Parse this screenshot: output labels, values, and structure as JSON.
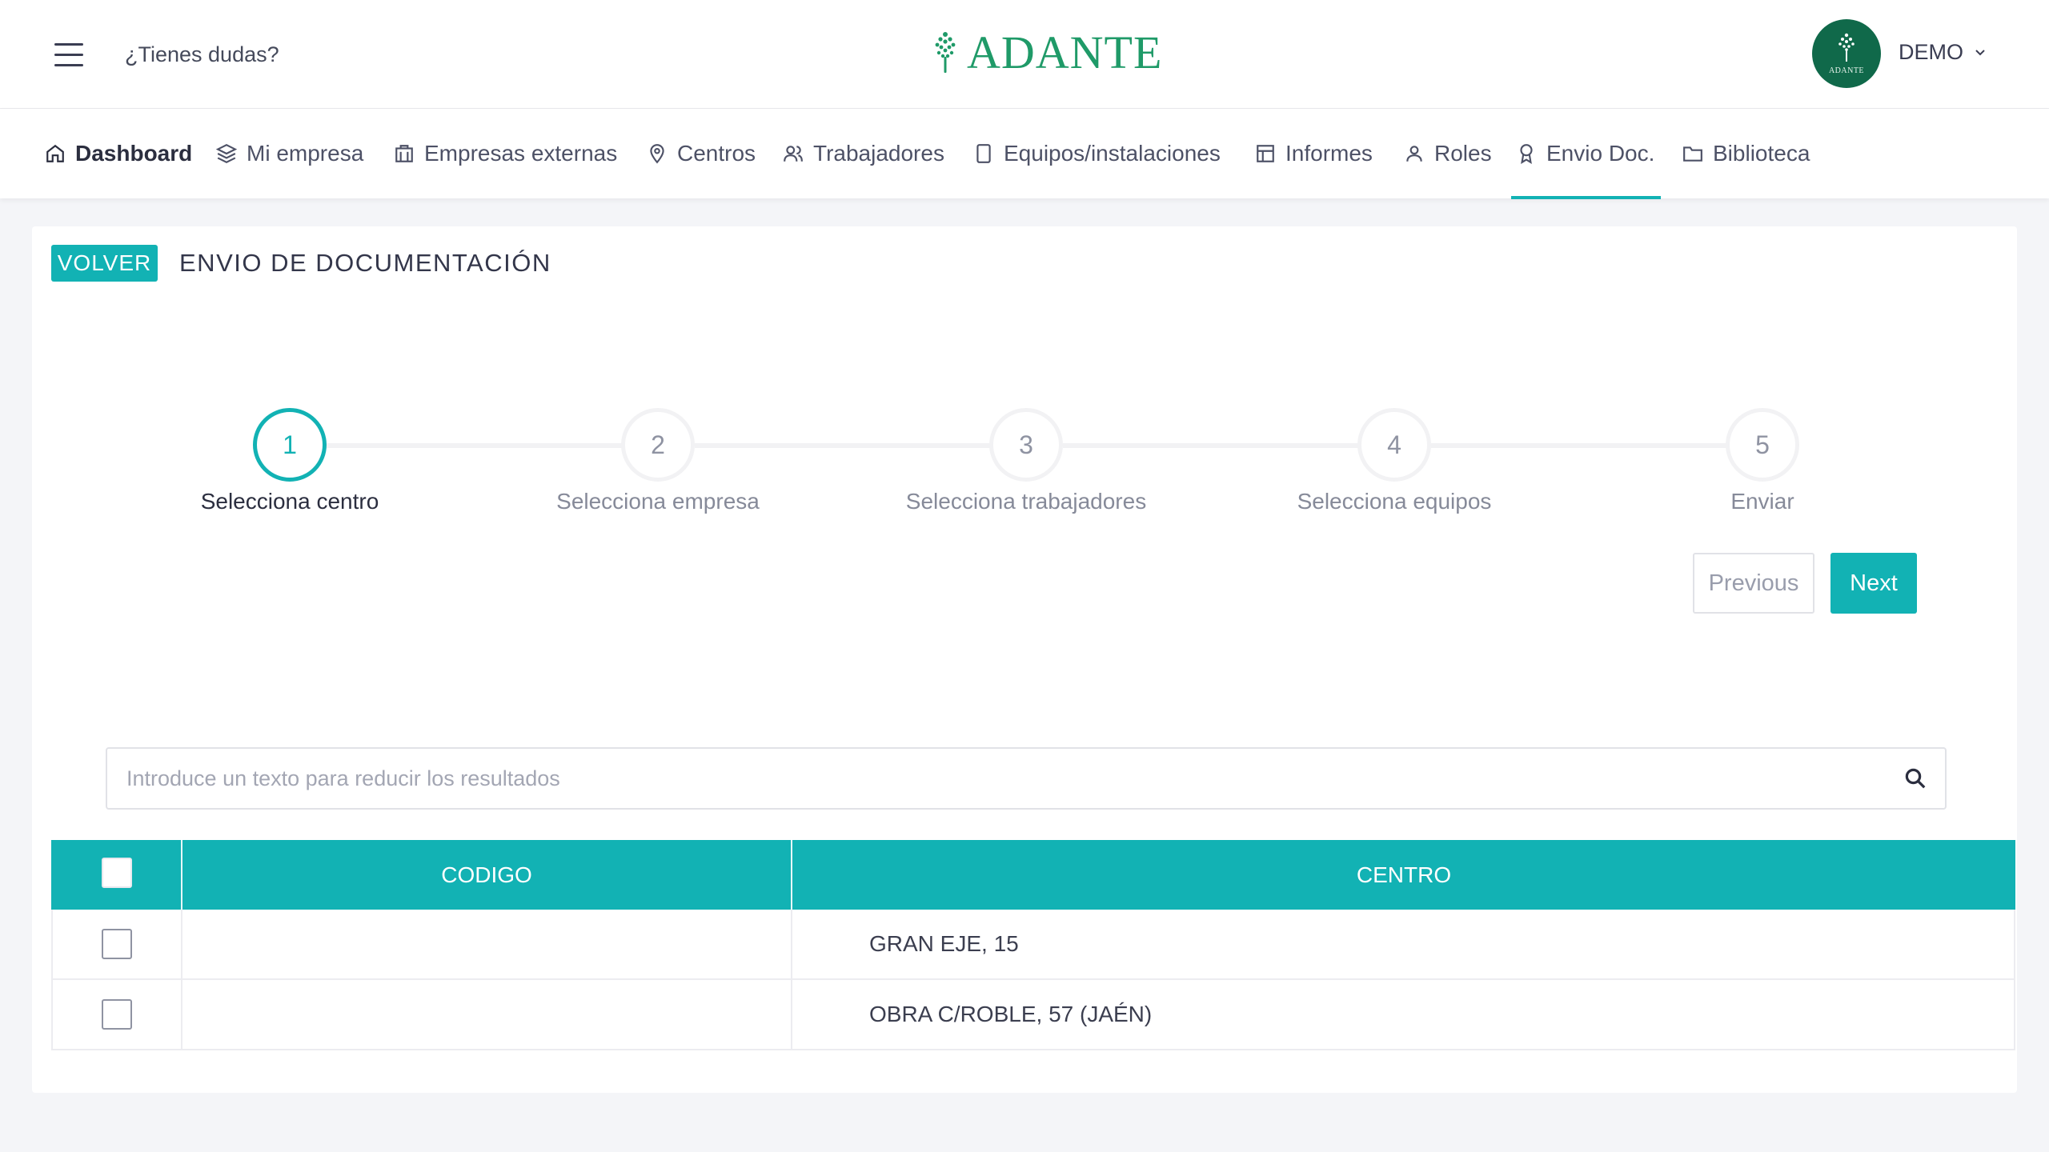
{
  "header": {
    "help_text": "¿Tienes dudas?",
    "logo_text": "ADANTE",
    "avatar_caption": "ADANTE",
    "user_name": "DEMO",
    "brand_color": "#1f9a68"
  },
  "nav": {
    "items": [
      {
        "label": "Dashboard",
        "icon": "home-icon"
      },
      {
        "label": "Mi empresa",
        "icon": "layers-icon"
      },
      {
        "label": "Empresas externas",
        "icon": "building-icon"
      },
      {
        "label": "Centros",
        "icon": "map-pin-icon"
      },
      {
        "label": "Trabajadores",
        "icon": "users-icon"
      },
      {
        "label": "Equipos/instalaciones",
        "icon": "tablet-icon"
      },
      {
        "label": "Informes",
        "icon": "layout-icon"
      },
      {
        "label": "Roles",
        "icon": "user-icon"
      },
      {
        "label": "Envio Doc.",
        "icon": "award-icon"
      },
      {
        "label": "Biblioteca",
        "icon": "folder-icon"
      }
    ],
    "active": "Envio Doc.",
    "accent_color": "#12b2b4"
  },
  "page": {
    "back_label": "VOLVER",
    "title": "ENVIO DE DOCUMENTACIÓN"
  },
  "stepper": {
    "active_step": 1,
    "steps": [
      {
        "number": "1",
        "label": "Selecciona centro"
      },
      {
        "number": "2",
        "label": "Selecciona empresa"
      },
      {
        "number": "3",
        "label": "Selecciona trabajadores"
      },
      {
        "number": "4",
        "label": "Selecciona equipos"
      },
      {
        "number": "5",
        "label": "Enviar"
      }
    ],
    "previous_label": "Previous",
    "next_label": "Next"
  },
  "search": {
    "placeholder": "Introduce un texto para reducir los resultados",
    "value": ""
  },
  "table": {
    "columns": [
      "CODIGO",
      "CENTRO"
    ],
    "rows": [
      {
        "codigo": "",
        "centro": "GRAN EJE, 15",
        "checked": false
      },
      {
        "codigo": "",
        "centro": "OBRA C/ROBLE, 57 (JAÉN)",
        "checked": false
      }
    ]
  }
}
